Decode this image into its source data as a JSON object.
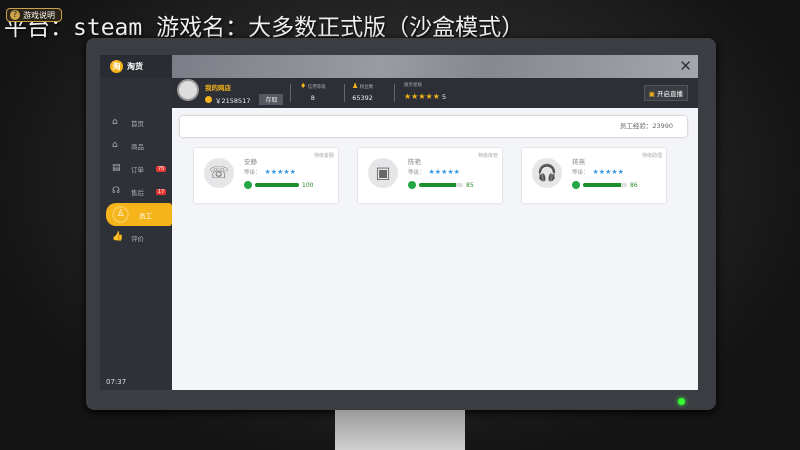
{
  "overlay": {
    "help_label": "游戏说明",
    "caption": "平台：steam 游戏名：大多数正式版（沙盒模式）"
  },
  "app": {
    "title": "淘货",
    "logo_char": "淘",
    "close": "✕",
    "time": "07:37"
  },
  "nav": [
    {
      "label": "首页",
      "icon": "⌂"
    },
    {
      "label": "商品",
      "icon": "⌂"
    },
    {
      "label": "订单",
      "icon": "▤",
      "badge": "75"
    },
    {
      "label": "售后",
      "icon": "☊",
      "badge": "17"
    },
    {
      "label": "员工",
      "icon": "♙"
    },
    {
      "label": "评价",
      "icon": "👍"
    }
  ],
  "header": {
    "shop_name": "我的网店",
    "balance": "￥2158517",
    "withdraw": "存取",
    "credit_label": "信用等级",
    "credit": "8",
    "fans_label": "粉丝数",
    "fans": "65392",
    "service_label": "服务星级",
    "service_stars": "★★★★★",
    "service": "5",
    "live_label": "开启直播"
  },
  "content": {
    "exp": "员工经验：23990",
    "employees": [
      {
        "name": "安静",
        "role": "特级客服",
        "level_label": "等级：",
        "stars": "★★★★★",
        "mood": 100,
        "icon": "☏"
      },
      {
        "name": "陈艳",
        "role": "特级库管",
        "level_label": "等级：",
        "stars": "★★★★★",
        "mood": 85,
        "icon": "▣"
      },
      {
        "name": "蒋燕",
        "role": "特级助理",
        "level_label": "等级：",
        "stars": "★★★★★",
        "mood": 86,
        "icon": "🎧"
      }
    ]
  },
  "colors": {
    "accent": "#f4b41a",
    "sidebar": "#2f3139",
    "mood": "#1b8f2b",
    "star": "#3a9be5"
  }
}
